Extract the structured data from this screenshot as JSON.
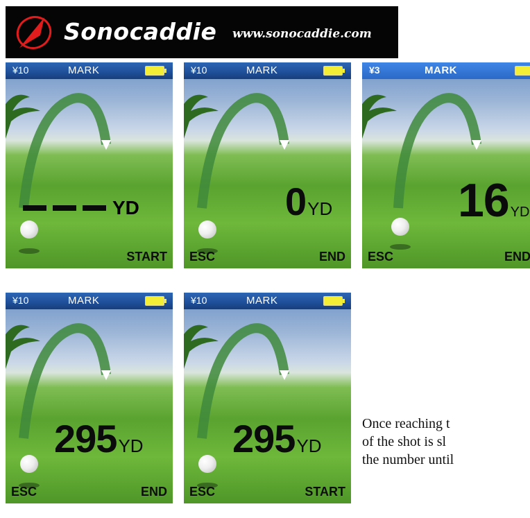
{
  "banner": {
    "brand": "Sonocaddie",
    "url": "www.sonocaddie.com"
  },
  "screens": [
    {
      "antenna": "¥10",
      "mode": "MARK",
      "distance": "",
      "dashes": true,
      "unit": "YD",
      "left_key": "",
      "right_key": "START"
    },
    {
      "antenna": "¥10",
      "mode": "MARK",
      "distance": "0",
      "dashes": false,
      "unit": "YD",
      "left_key": "ESC",
      "right_key": "END"
    },
    {
      "antenna": "¥3",
      "mode": "MARK",
      "distance": "16",
      "dashes": false,
      "unit": "YD",
      "left_key": "ESC",
      "right_key": "END"
    },
    {
      "antenna": "¥10",
      "mode": "MARK",
      "distance": "295",
      "dashes": false,
      "unit": "YD",
      "left_key": "ESC",
      "right_key": "END"
    },
    {
      "antenna": "¥10",
      "mode": "MARK",
      "distance": "295",
      "dashes": false,
      "unit": "YD",
      "left_key": "ESC",
      "right_key": "START"
    }
  ],
  "caption": {
    "line1": "Once reaching t",
    "line2": "of the shot is sl",
    "line3": "the number until"
  },
  "icons": {
    "logo": "sonocaddie-logo-icon",
    "antenna": "antenna-signal-icon",
    "battery": "battery-icon",
    "ball": "golf-ball-icon",
    "arc": "shot-arc-icon"
  },
  "colors": {
    "statusbar": "#1f4f99",
    "battery": "#f4ee37",
    "logo": "#e01c1c"
  }
}
